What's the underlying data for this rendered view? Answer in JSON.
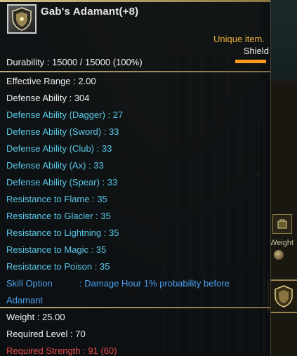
{
  "item": {
    "name": "Gab's Adamant(+8)",
    "rarity": "Unique item.",
    "type": "Shield",
    "durability": "Durability : 15000 / 15000 (100%)",
    "durability_fraction": 1.0
  },
  "stats": [
    {
      "text": "Effective Range : 2.00",
      "color": "white"
    },
    {
      "text": "Defense Ability : 304",
      "color": "white"
    },
    {
      "text": "Defense Ability (Dagger) : 27",
      "color": "cyan"
    },
    {
      "text": "Defense Ability (Sword) : 33",
      "color": "cyan"
    },
    {
      "text": "Defense Ability (Club) : 33",
      "color": "cyan"
    },
    {
      "text": "Defense Ability (Ax) : 33",
      "color": "cyan"
    },
    {
      "text": "Defense Ability (Spear) : 33",
      "color": "cyan"
    },
    {
      "text": "Resistance to Flame : 35",
      "color": "cyan"
    },
    {
      "text": "Resistance to Glacier : 35",
      "color": "cyan"
    },
    {
      "text": "Resistance to Lightning : 35",
      "color": "cyan"
    },
    {
      "text": "Resistance to Magic : 35",
      "color": "cyan"
    },
    {
      "text": "Resistance to Poison : 35",
      "color": "cyan"
    }
  ],
  "skill": {
    "label": "Skill Option",
    "value": ": Damage Hour 1% probability before",
    "continuation": "Adamant"
  },
  "requirements": {
    "weight": "Weight : 25.00",
    "level": "Required Level : 70",
    "strength": "Required Strength : 91 (60)"
  },
  "side_panel": {
    "weight_label": "Weight"
  },
  "colors": {
    "white": "#f0f0f0",
    "cyan": "#5ac8e6",
    "blue": "#4aa0f0",
    "red": "#e24848",
    "gold": "#e9b13a",
    "orange_bar": "#ff9a1a"
  },
  "icons": {
    "item_icon": "shield-icon",
    "side_item_icon": "shield-icon",
    "slot_icon": "bag-icon"
  }
}
